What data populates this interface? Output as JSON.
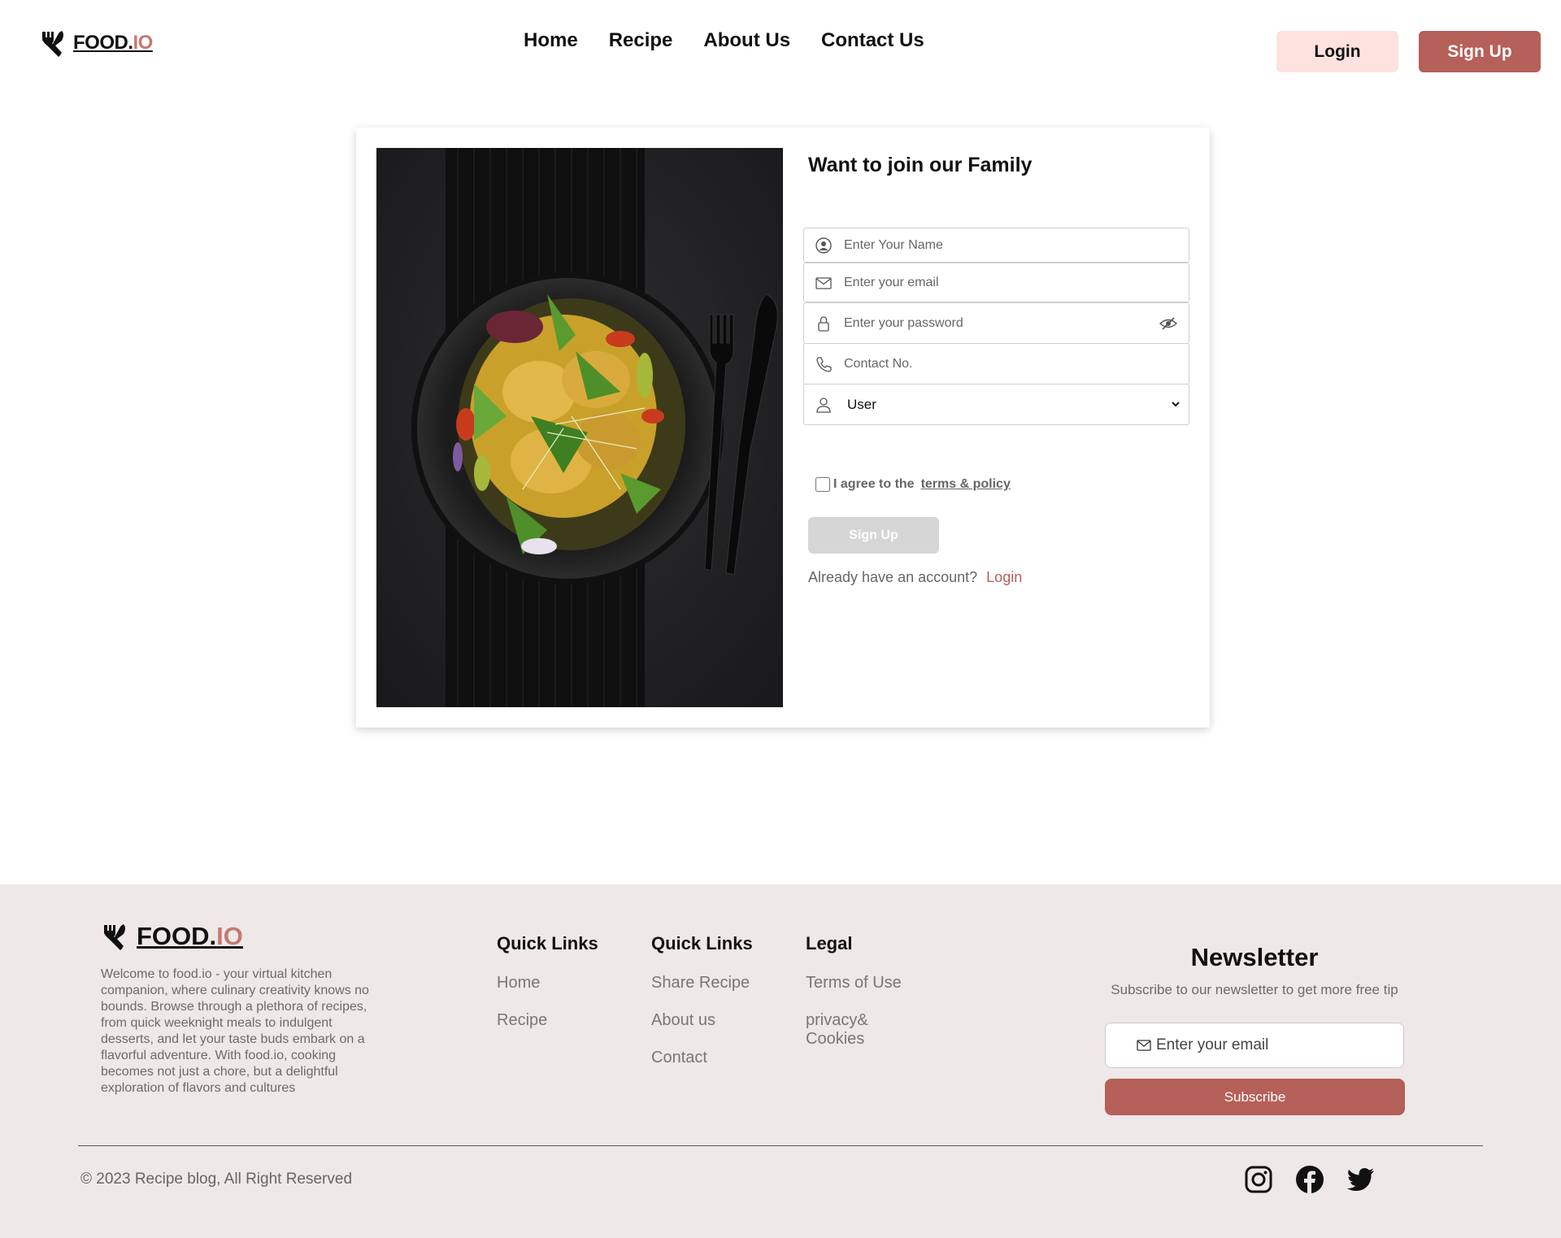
{
  "header": {
    "logo_main": "FOOD.",
    "logo_accent": "IO",
    "nav": [
      "Home",
      "Recipe",
      "About Us",
      "Contact Us"
    ],
    "login_label": "Login",
    "signup_label": "Sign Up"
  },
  "form": {
    "title": "Want to join our Family",
    "name_placeholder": "Enter Your Name",
    "email_placeholder": "Enter your email",
    "password_placeholder": "Enter your password",
    "contact_placeholder": "Contact No.",
    "role_selected": "User",
    "agree_text": "I agree to the",
    "terms_link": "terms & policy",
    "submit_label": "Sign Up",
    "already_text": "Already have an account?",
    "login_link": "Login"
  },
  "icons": {
    "logo": "fork-knife-icon",
    "name": "user-circle-icon",
    "email": "envelope-icon",
    "password": "lock-icon",
    "password_toggle": "eye-slash-icon",
    "contact": "phone-icon",
    "role": "user-icon",
    "social": [
      "instagram-icon",
      "facebook-icon",
      "twitter-icon"
    ]
  },
  "footer": {
    "logo_main": "FOOD.",
    "logo_accent": "IO",
    "description": "Welcome to food.io - your virtual kitchen companion, where culinary creativity knows no bounds. Browse through a plethora of recipes, from quick weeknight meals to indulgent desserts, and let your taste buds embark on a flavorful adventure. With food.io, cooking becomes not just a chore, but a delightful exploration of flavors and cultures",
    "columns": [
      {
        "title": "Quick Links",
        "links": [
          "Home",
          "Recipe"
        ]
      },
      {
        "title": "Quick Links",
        "links": [
          "Share Recipe",
          "About us",
          "Contact"
        ]
      },
      {
        "title": "Legal",
        "links": [
          "Terms of Use",
          "privacy& Cookies"
        ]
      }
    ],
    "newsletter": {
      "title": "Newsletter",
      "subtitle": "Subscribe to our newsletter to get more free tip",
      "email_placeholder": "Enter your email",
      "button_label": "Subscribe"
    },
    "copyright": "© 2023 Recipe blog, All Right Reserved"
  },
  "colors": {
    "accent": "#b56059",
    "accent_light": "#fde2e0",
    "logo_accent": "#c47a70",
    "footer_bg": "#efe8e8",
    "disabled_button": "#d6d6d6"
  }
}
